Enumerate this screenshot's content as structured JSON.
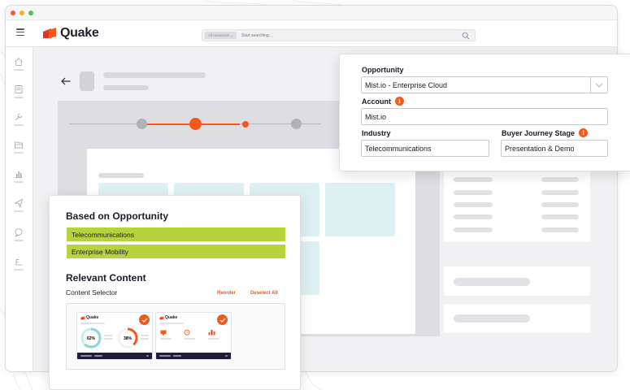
{
  "app": {
    "name": "Quake",
    "brand_colors": {
      "orange": "#f2591c",
      "red": "#e8312a",
      "navy": "#231b3a",
      "lime": "#b5d33c",
      "teal": "#ddf1f3"
    }
  },
  "search": {
    "chip_label": "All resources ⌄",
    "placeholder": "Start searching..."
  },
  "sidebar": {
    "items": [
      {
        "icon": "home-icon"
      },
      {
        "icon": "document-icon"
      },
      {
        "icon": "tools-icon"
      },
      {
        "icon": "folder-icon"
      },
      {
        "icon": "bar-chart-icon"
      },
      {
        "icon": "send-icon"
      },
      {
        "icon": "chat-icon"
      },
      {
        "icon": "user-icon"
      }
    ]
  },
  "opportunity_form": {
    "opportunity_label": "Opportunity",
    "opportunity_value": "Mist.io - Enterprise Cloud",
    "account_label": "Account",
    "account_value": "Mist.io",
    "industry_label": "Industry",
    "industry_value": "Telecommunications",
    "stage_label": "Buyer Journey Stage",
    "stage_value": "Presentation & Demo",
    "info_glyph": "i"
  },
  "relevant_panel": {
    "based_on_heading": "Based on Opportunity",
    "tags": [
      "Telecommunications",
      "Enterprise Mobility"
    ],
    "relevant_heading": "Relevant Content",
    "content_selector_label": "Content Selector",
    "reorder_label": "Reorder",
    "deselect_all_label": "Deselect All",
    "thumbnails": [
      {
        "logo": "Quake",
        "stats": [
          "62%",
          "38%"
        ],
        "selected": true
      },
      {
        "logo": "Quake",
        "selected": true
      }
    ]
  }
}
